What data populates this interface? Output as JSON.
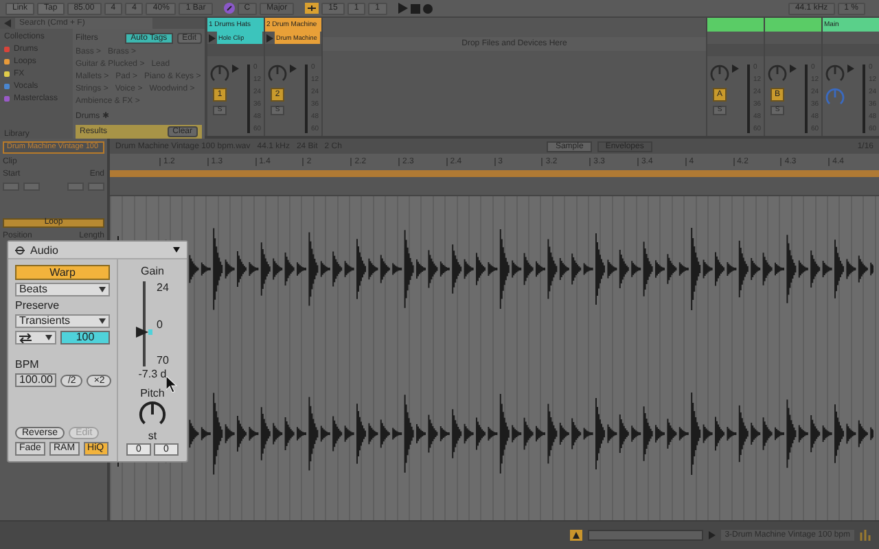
{
  "transport": {
    "tempo_group": [
      {
        "kind": "button",
        "text": "Link"
      },
      {
        "kind": "button",
        "text": "Tap"
      },
      {
        "kind": "field",
        "text": "85.00"
      },
      {
        "kind": "field",
        "text": "4"
      },
      {
        "kind": "field",
        "text": "4"
      },
      {
        "kind": "field",
        "text": "40%"
      },
      {
        "kind": "dropdown",
        "text": "1 Bar"
      }
    ],
    "key_group": [
      {
        "kind": "dropdown",
        "text": "C"
      },
      {
        "kind": "dropdown",
        "text": "Major"
      }
    ],
    "position_group": [
      {
        "kind": "field",
        "text": "15"
      },
      {
        "kind": "field",
        "text": "1"
      },
      {
        "kind": "field",
        "text": "1"
      }
    ],
    "audio_group": [
      {
        "kind": "dropdown",
        "text": "44.1 kHz"
      },
      {
        "kind": "dropdown",
        "text": "1 %"
      }
    ]
  },
  "browser": {
    "search": {
      "placeholder": "Search (Cmd + F)"
    },
    "collections_title": "Collections",
    "collections": [
      {
        "label": "Drums",
        "color": "#d8443a"
      },
      {
        "label": "Loops",
        "color": "#e89a3a"
      },
      {
        "label": "FX",
        "color": "#e0cc4a"
      },
      {
        "label": "Vocals",
        "color": "#4a86d0"
      },
      {
        "label": "Masterclass",
        "color": "#9a5ac8"
      }
    ],
    "library": "Library",
    "filters": {
      "title": "Filters",
      "auto_tags": {
        "label": "Auto Tags",
        "on": true
      },
      "edit": "Edit",
      "tag_lines": [
        "Bass >   Brass >",
        "Guitar & Plucked >   Lead",
        "Mallets >   Pad >   Piano & Keys >",
        "Strings >   Voice >   Woodwind >",
        "Ambience & FX >"
      ],
      "selected_tag": "Drums ✱",
      "results": "Results",
      "clear": "Clear"
    }
  },
  "tracks": [
    {
      "name": "1 Drums Hats",
      "color": "#3cc4bc",
      "clip": "Hole Clip",
      "number": "1",
      "solo": "S",
      "scale": [
        "0",
        "12",
        "24",
        "36",
        "48",
        "60"
      ]
    },
    {
      "name": "2 Drum Machine",
      "color": "#e8a038",
      "clip": "Drum Machine",
      "number": "2",
      "solo": "S",
      "scale": [
        "0",
        "12",
        "24",
        "36",
        "48",
        "60"
      ]
    }
  ],
  "drop_hint": "Drop Files and Devices Here",
  "returns": [
    {
      "kind": "return",
      "color": "#5acc66",
      "number": "A",
      "solo": "S",
      "scale": [
        "0",
        "12",
        "24",
        "36",
        "48",
        "60"
      ]
    },
    {
      "kind": "return",
      "color": "#5acc66",
      "number": "B",
      "solo": "S",
      "scale": [
        "0",
        "12",
        "24",
        "36",
        "48",
        "60"
      ]
    },
    {
      "kind": "main",
      "name": "Main",
      "color": "#5ad08a",
      "scale": [
        "0",
        "12",
        "24",
        "36",
        "48",
        "60"
      ]
    }
  ],
  "clip": {
    "title": "Drum Machine Vintage 100",
    "section": "Clip",
    "start": "Start",
    "end": "End",
    "loop": {
      "label": "Loop",
      "on": true
    },
    "position": "Position",
    "length": "Length"
  },
  "editor": {
    "file_info": "Drum Machine Vintage 100 bpm.wav   44.1 kHz   24 Bit   2 Ch",
    "tabs": [
      {
        "label": "Sample",
        "selected": true
      },
      {
        "label": "Envelopes",
        "selected": false
      }
    ],
    "grid": "1/16",
    "ruler": [
      "1.2",
      "1.3",
      "1.4",
      "2",
      "2.2",
      "2.3",
      "2.4",
      "3",
      "3.2",
      "3.3",
      "3.4",
      "4",
      "4.2",
      "4.3",
      "4.4"
    ]
  },
  "audio": {
    "title": "Audio",
    "warp": {
      "label": "Warp",
      "on": true
    },
    "mode": "Beats",
    "preserve_label": "Preserve",
    "preserve": "Transients",
    "loop_value": "100",
    "bpm_label": "BPM",
    "bpm": "100.00",
    "halve": "/2",
    "double": "×2",
    "reverse": {
      "label": "Reverse",
      "disabled": false
    },
    "edit": {
      "label": "Edit",
      "disabled": true
    },
    "fade": {
      "label": "Fade",
      "on": false
    },
    "ram": {
      "label": "RAM",
      "on": false
    },
    "hiq": {
      "label": "HiQ",
      "on": true
    },
    "gain": {
      "label": "Gain",
      "max": "24",
      "mid": "0",
      "min": "70",
      "value": "-7.3 d",
      "level": 0.4
    },
    "pitch": {
      "label": "Pitch",
      "unit": "st",
      "semitones": "0",
      "cents": "0"
    }
  },
  "status": {
    "clip_name": "3-Drum Machine Vintage 100 bpm"
  }
}
